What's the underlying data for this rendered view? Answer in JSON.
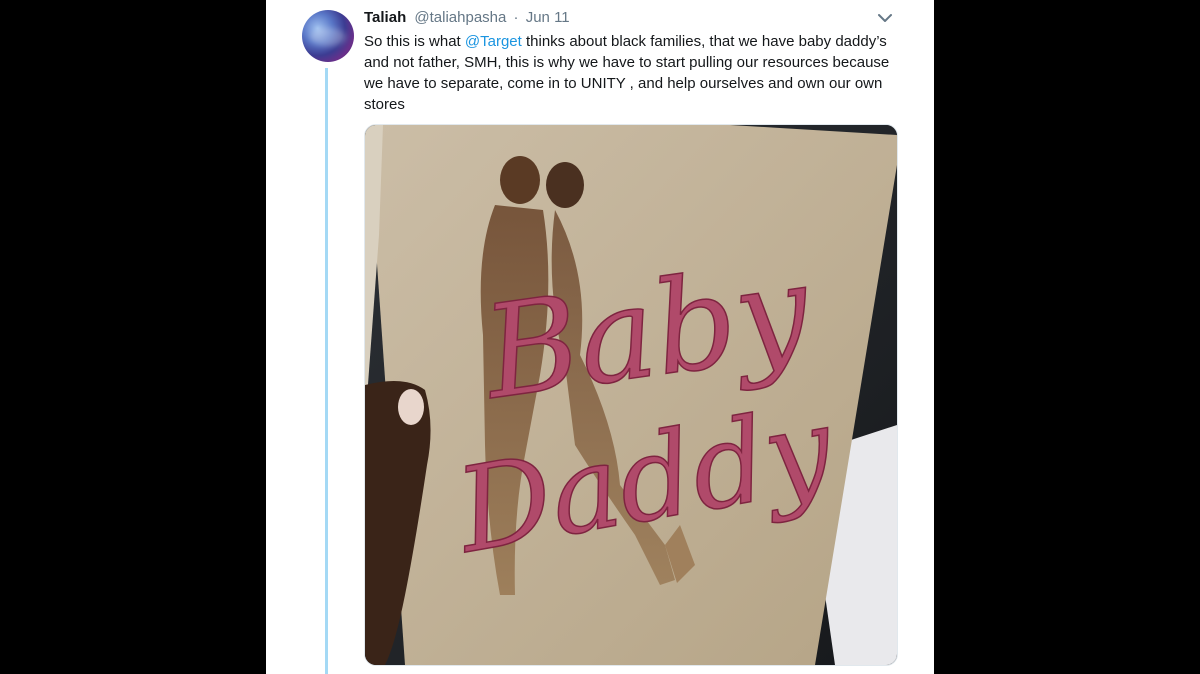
{
  "tweet": {
    "author_name": "Taliah",
    "author_handle": "@taliahpasha",
    "separator": "·",
    "date": "Jun 11",
    "text_before_mention": "So this is what ",
    "mention": "@Target",
    "text_after_mention": " thinks about black families, that we have baby daddy’s and not father, SMH, this is why we have to start pulling our resources because we have to separate, come in to UNITY , and help ourselves and own our own stores",
    "media": {
      "card_word_1": "Baby",
      "card_word_2": "Daddy"
    }
  },
  "colors": {
    "link": "#1b95e0",
    "thread_line": "#a4d9f5",
    "card_lettering": "#b04a6a"
  },
  "icons": {
    "more": "chevron-down-icon"
  }
}
